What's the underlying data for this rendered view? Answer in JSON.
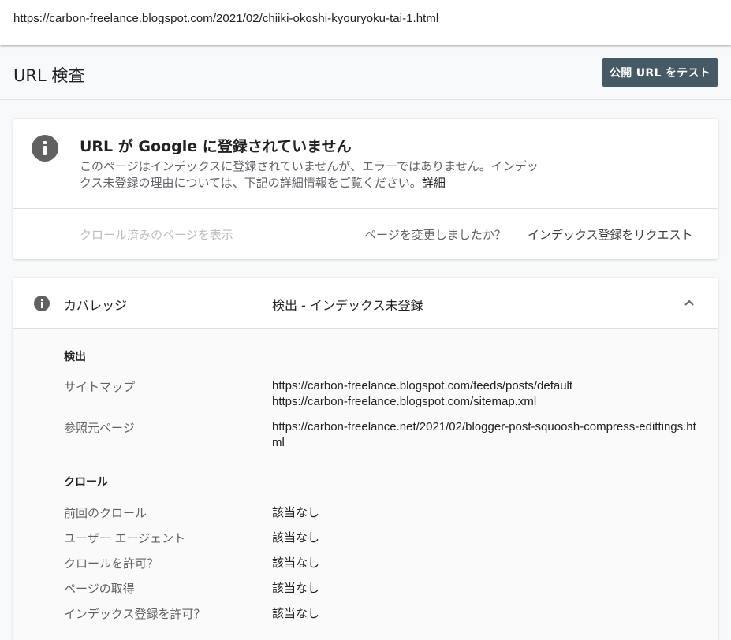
{
  "url_bar": {
    "url": "https://carbon-freelance.blogspot.com/2021/02/chiiki-okoshi-kyouryoku-tai-1.html"
  },
  "header": {
    "title": "URL 検査",
    "test_button": "公開 URL をテスト"
  },
  "status_card": {
    "icon": "info-icon",
    "headline": "URL が Google に登録されていません",
    "description": "このページはインデックスに登録されていませんが、エラーではありません。インデックス未登録の理由については、下記の詳細情報をご覧ください。",
    "more_link": "詳細",
    "view_crawled": "クロール済みのページを表示",
    "changed_question": "ページを変更しましたか？",
    "request_indexing": "インデックス登録をリクエスト"
  },
  "coverage": {
    "icon": "info-icon",
    "label": "カバレッジ",
    "status": "検出 - インデックス未登録",
    "discovery": {
      "heading": "検出",
      "sitemap_label": "サイトマップ",
      "sitemaps": [
        "https://carbon-freelance.blogspot.com/feeds/posts/default",
        "https://carbon-freelance.blogspot.com/sitemap.xml"
      ],
      "referring_label": "参照元ページ",
      "referring_page": "https://carbon-freelance.net/2021/02/blogger-post-squoosh-compress-edittings.html"
    },
    "crawl": {
      "heading": "クロール",
      "rows": [
        {
          "label": "前回のクロール",
          "value": "該当なし"
        },
        {
          "label": "ユーザー エージェント",
          "value": "該当なし"
        },
        {
          "label": "クロールを許可？",
          "value": "該当なし"
        },
        {
          "label": "ページの取得",
          "value": "該当なし"
        },
        {
          "label": "インデックス登録を許可？",
          "value": "該当なし"
        }
      ]
    }
  },
  "colors": {
    "button_bg": "#455a64",
    "icon_gray": "#616161"
  }
}
